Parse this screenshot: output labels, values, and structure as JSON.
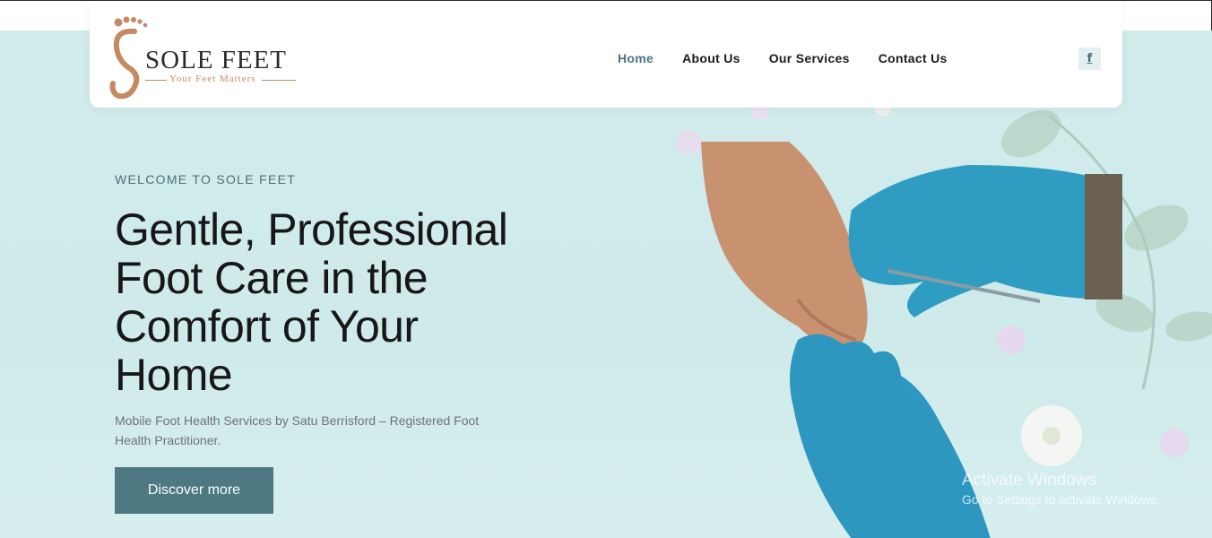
{
  "brand": {
    "name": "SOLE FEET",
    "tagline": "Your Feet Matters",
    "logo_icon": "footprint-icon",
    "accent_color": "#c58a64"
  },
  "nav": {
    "items": [
      {
        "label": "Home",
        "active": true
      },
      {
        "label": "About Us",
        "active": false
      },
      {
        "label": "Our Services",
        "active": false
      },
      {
        "label": "Contact Us",
        "active": false
      }
    ],
    "active_color": "#4a7480"
  },
  "social": {
    "facebook_glyph": "f",
    "icon": "facebook-icon"
  },
  "hero": {
    "eyebrow": "WELCOME TO SOLE FEET",
    "headline": "Gentle, Professional Foot Care in the Comfort of Your Home",
    "subtext": "Mobile Foot Health Services by Satu Berrisford – Registered Foot Health Practitioner.",
    "cta_label": "Discover more",
    "cta_color": "#4e7882",
    "background_color": "#d2ecec"
  },
  "watermark": {
    "title": "Activate Windows",
    "subtitle": "Go to Settings to activate Windows."
  }
}
